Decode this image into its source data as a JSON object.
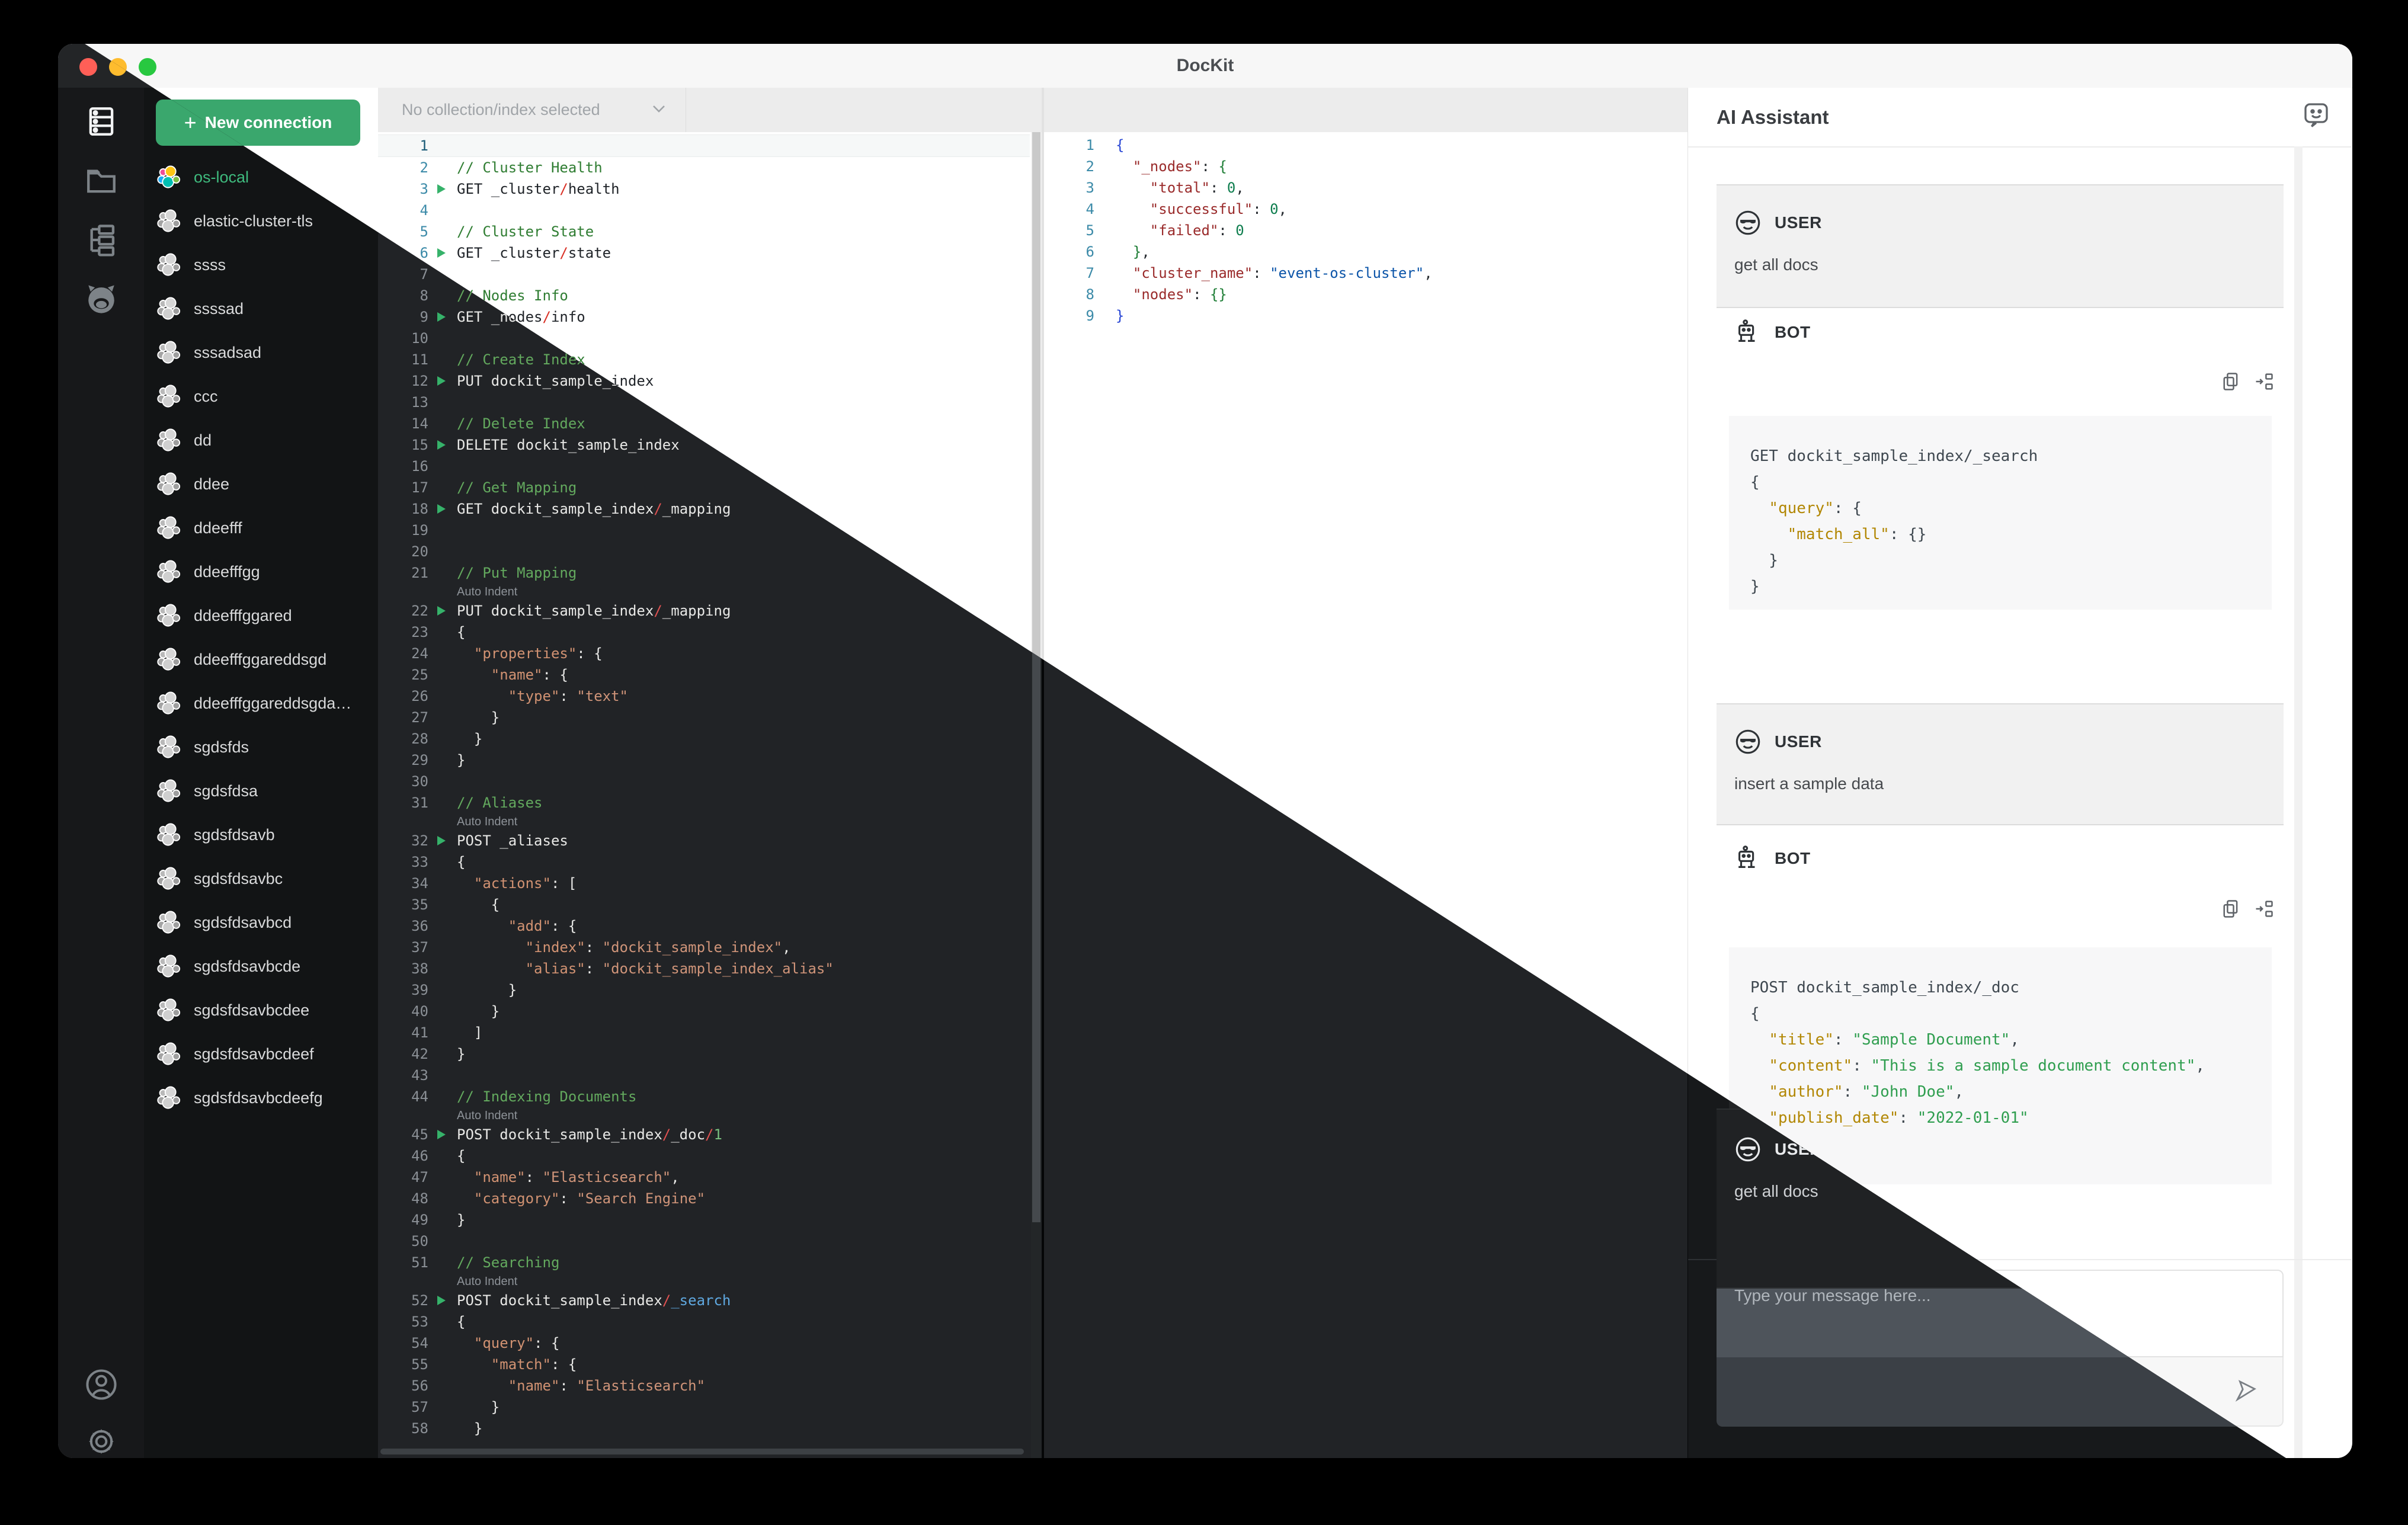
{
  "window": {
    "title": "DocKit",
    "traffic_lights": [
      "close",
      "minimize",
      "zoom"
    ]
  },
  "rail": {
    "top_icons": [
      "connections-icon",
      "folder-icon",
      "tree-icon",
      "github-icon"
    ],
    "bottom_icons": [
      "user-icon",
      "gear-icon"
    ]
  },
  "connections": {
    "new_button_label": "New connection",
    "items": [
      {
        "name": "os-local",
        "active": true
      },
      {
        "name": "elastic-cluster-tls",
        "active": false
      },
      {
        "name": "ssss",
        "active": false
      },
      {
        "name": "ssssad",
        "active": false
      },
      {
        "name": "sssadsad",
        "active": false
      },
      {
        "name": "ccc",
        "active": false
      },
      {
        "name": "dd",
        "active": false
      },
      {
        "name": "ddee",
        "active": false
      },
      {
        "name": "ddeefff",
        "active": false
      },
      {
        "name": "ddeefffgg",
        "active": false
      },
      {
        "name": "ddeefffggared",
        "active": false
      },
      {
        "name": "ddeefffggareddsgd",
        "active": false
      },
      {
        "name": "ddeefffggareddsgda…",
        "active": false
      },
      {
        "name": "sgdsfds",
        "active": false
      },
      {
        "name": "sgdsfdsa",
        "active": false
      },
      {
        "name": "sgdsfdsavb",
        "active": false
      },
      {
        "name": "sgdsfdsavbc",
        "active": false
      },
      {
        "name": "sgdsfdsavbcd",
        "active": false
      },
      {
        "name": "sgdsfdsavbcde",
        "active": false
      },
      {
        "name": "sgdsfdsavbcdee",
        "active": false
      },
      {
        "name": "sgdsfdsavbcdeef",
        "active": false
      },
      {
        "name": "sgdsfdsavbcdeefg",
        "active": false
      }
    ]
  },
  "toolbar": {
    "collection_placeholder": "No collection/index selected"
  },
  "editor": {
    "lens_label": "Auto Indent",
    "lines": [
      {
        "n": 1,
        "hl": true,
        "segs": []
      },
      {
        "n": 2,
        "segs": [
          [
            "// Cluster Health",
            "c"
          ]
        ]
      },
      {
        "n": 3,
        "run": true,
        "segs": [
          [
            "GET _cluster",
            "t"
          ],
          [
            "/",
            "s"
          ],
          [
            "health",
            "t"
          ]
        ]
      },
      {
        "n": 4,
        "segs": []
      },
      {
        "n": 5,
        "segs": [
          [
            "// Cluster State",
            "c"
          ]
        ]
      },
      {
        "n": 6,
        "run": true,
        "segs": [
          [
            "GET _cluster",
            "t"
          ],
          [
            "/",
            "s"
          ],
          [
            "state",
            "t"
          ]
        ]
      },
      {
        "n": 7,
        "segs": []
      },
      {
        "n": 8,
        "segs": [
          [
            "// Nodes Info",
            "c"
          ]
        ]
      },
      {
        "n": 9,
        "run": true,
        "segs": [
          [
            "GET _nodes",
            "t"
          ],
          [
            "/",
            "s"
          ],
          [
            "info",
            "t"
          ]
        ]
      },
      {
        "n": 10,
        "segs": []
      },
      {
        "n": 11,
        "segs": [
          [
            "// Create Index",
            "c"
          ]
        ]
      },
      {
        "n": 12,
        "run": true,
        "segs": [
          [
            "PUT dockit_sample_index",
            "t"
          ]
        ]
      },
      {
        "n": 13,
        "segs": []
      },
      {
        "n": 14,
        "segs": [
          [
            "// Delete Index",
            "c"
          ]
        ]
      },
      {
        "n": 15,
        "run": true,
        "segs": [
          [
            "DELETE dockit_sample_index",
            "t"
          ]
        ]
      },
      {
        "n": 16,
        "segs": []
      },
      {
        "n": 17,
        "segs": [
          [
            "// Get Mapping",
            "c"
          ]
        ]
      },
      {
        "n": 18,
        "run": true,
        "segs": [
          [
            "GET dockit_sample_index",
            "t"
          ],
          [
            "/",
            "s"
          ],
          [
            "_mapping",
            "t"
          ]
        ]
      },
      {
        "n": 19,
        "segs": []
      },
      {
        "n": 20,
        "segs": []
      },
      {
        "n": 21,
        "segs": [
          [
            "// Put Mapping",
            "c"
          ]
        ]
      },
      {
        "lens": true
      },
      {
        "n": 22,
        "run": true,
        "segs": [
          [
            "PUT dockit_sample_index",
            "t"
          ],
          [
            "/",
            "s"
          ],
          [
            "_mapping",
            "t"
          ]
        ]
      },
      {
        "n": 23,
        "segs": [
          [
            "{",
            "t"
          ]
        ]
      },
      {
        "n": 24,
        "segs": [
          [
            "  ",
            "t"
          ],
          [
            "\"properties\"",
            "k"
          ],
          [
            ": {",
            "t"
          ]
        ]
      },
      {
        "n": 25,
        "segs": [
          [
            "    ",
            "t"
          ],
          [
            "\"name\"",
            "k"
          ],
          [
            ": {",
            "t"
          ]
        ]
      },
      {
        "n": 26,
        "segs": [
          [
            "      ",
            "t"
          ],
          [
            "\"type\"",
            "k"
          ],
          [
            ": ",
            "t"
          ],
          [
            "\"text\"",
            "v"
          ]
        ]
      },
      {
        "n": 27,
        "segs": [
          [
            "    }",
            "t"
          ]
        ]
      },
      {
        "n": 28,
        "segs": [
          [
            "  }",
            "t"
          ]
        ]
      },
      {
        "n": 29,
        "segs": [
          [
            "}",
            "t"
          ]
        ]
      },
      {
        "n": 30,
        "segs": []
      },
      {
        "n": 31,
        "segs": [
          [
            "// Aliases",
            "c"
          ]
        ]
      },
      {
        "lens": true
      },
      {
        "n": 32,
        "run": true,
        "segs": [
          [
            "POST _aliases",
            "t"
          ]
        ]
      },
      {
        "n": 33,
        "segs": [
          [
            "{",
            "t"
          ]
        ]
      },
      {
        "n": 34,
        "segs": [
          [
            "  ",
            "t"
          ],
          [
            "\"actions\"",
            "k"
          ],
          [
            ": [",
            "t"
          ]
        ]
      },
      {
        "n": 35,
        "segs": [
          [
            "    {",
            "t"
          ]
        ]
      },
      {
        "n": 36,
        "segs": [
          [
            "      ",
            "t"
          ],
          [
            "\"add\"",
            "k"
          ],
          [
            ": {",
            "t"
          ]
        ]
      },
      {
        "n": 37,
        "segs": [
          [
            "        ",
            "t"
          ],
          [
            "\"index\"",
            "k"
          ],
          [
            ": ",
            "t"
          ],
          [
            "\"dockit_sample_index\"",
            "v"
          ],
          [
            ",",
            "t"
          ]
        ]
      },
      {
        "n": 38,
        "segs": [
          [
            "        ",
            "t"
          ],
          [
            "\"alias\"",
            "k"
          ],
          [
            ": ",
            "t"
          ],
          [
            "\"dockit_sample_index_alias\"",
            "v"
          ]
        ]
      },
      {
        "n": 39,
        "segs": [
          [
            "      }",
            "t"
          ]
        ]
      },
      {
        "n": 40,
        "segs": [
          [
            "    }",
            "t"
          ]
        ]
      },
      {
        "n": 41,
        "segs": [
          [
            "  ]",
            "t"
          ]
        ]
      },
      {
        "n": 42,
        "segs": [
          [
            "}",
            "t"
          ]
        ]
      },
      {
        "n": 43,
        "segs": []
      },
      {
        "n": 44,
        "segs": [
          [
            "// Indexing Documents",
            "c"
          ]
        ]
      },
      {
        "lens": true
      },
      {
        "n": 45,
        "run": true,
        "segs": [
          [
            "POST dockit_sample_index",
            "t"
          ],
          [
            "/",
            "s"
          ],
          [
            "_doc",
            "t"
          ],
          [
            "/",
            "s"
          ],
          [
            "1",
            "n"
          ]
        ]
      },
      {
        "n": 46,
        "segs": [
          [
            "{",
            "t"
          ]
        ]
      },
      {
        "n": 47,
        "segs": [
          [
            "  ",
            "t"
          ],
          [
            "\"name\"",
            "k"
          ],
          [
            ": ",
            "t"
          ],
          [
            "\"Elasticsearch\"",
            "v"
          ],
          [
            ",",
            "t"
          ]
        ]
      },
      {
        "n": 48,
        "segs": [
          [
            "  ",
            "t"
          ],
          [
            "\"category\"",
            "k"
          ],
          [
            ": ",
            "t"
          ],
          [
            "\"Search Engine\"",
            "v"
          ]
        ]
      },
      {
        "n": 49,
        "segs": [
          [
            "}",
            "t"
          ]
        ]
      },
      {
        "n": 50,
        "segs": []
      },
      {
        "n": 51,
        "segs": [
          [
            "// Searching",
            "c"
          ]
        ]
      },
      {
        "lens": true
      },
      {
        "n": 52,
        "run": true,
        "segs": [
          [
            "POST dockit_sample_index",
            "t"
          ],
          [
            "/",
            "s"
          ],
          [
            "_search",
            "b"
          ]
        ]
      },
      {
        "n": 53,
        "segs": [
          [
            "{",
            "t"
          ]
        ]
      },
      {
        "n": 54,
        "segs": [
          [
            "  ",
            "t"
          ],
          [
            "\"query\"",
            "k"
          ],
          [
            ": {",
            "t"
          ]
        ]
      },
      {
        "n": 55,
        "segs": [
          [
            "    ",
            "t"
          ],
          [
            "\"match\"",
            "k"
          ],
          [
            ": {",
            "t"
          ]
        ]
      },
      {
        "n": 56,
        "segs": [
          [
            "      ",
            "t"
          ],
          [
            "\"name\"",
            "k"
          ],
          [
            ": ",
            "t"
          ],
          [
            "\"Elasticsearch\"",
            "v"
          ]
        ]
      },
      {
        "n": 57,
        "segs": [
          [
            "    }",
            "t"
          ]
        ]
      },
      {
        "n": 58,
        "segs": [
          [
            "  }",
            "t"
          ]
        ]
      }
    ]
  },
  "results": {
    "lines": [
      {
        "n": 1,
        "segs": [
          [
            "{",
            "b1"
          ]
        ]
      },
      {
        "n": 2,
        "segs": [
          [
            "  ",
            "t"
          ],
          [
            "\"_nodes\"",
            "rk"
          ],
          [
            ": ",
            "t"
          ],
          [
            "{",
            "b2"
          ]
        ]
      },
      {
        "n": 3,
        "segs": [
          [
            "    ",
            "t"
          ],
          [
            "\"total\"",
            "rk"
          ],
          [
            ": ",
            "t"
          ],
          [
            "0",
            "rn"
          ],
          [
            ",",
            "t"
          ]
        ]
      },
      {
        "n": 4,
        "segs": [
          [
            "    ",
            "t"
          ],
          [
            "\"successful\"",
            "rk"
          ],
          [
            ": ",
            "t"
          ],
          [
            "0",
            "rn"
          ],
          [
            ",",
            "t"
          ]
        ]
      },
      {
        "n": 5,
        "segs": [
          [
            "    ",
            "t"
          ],
          [
            "\"failed\"",
            "rk"
          ],
          [
            ": ",
            "t"
          ],
          [
            "0",
            "rn"
          ]
        ]
      },
      {
        "n": 6,
        "segs": [
          [
            "  ",
            "t"
          ],
          [
            "}",
            "b2"
          ],
          [
            ",",
            "t"
          ]
        ]
      },
      {
        "n": 7,
        "segs": [
          [
            "  ",
            "t"
          ],
          [
            "\"cluster_name\"",
            "rk"
          ],
          [
            ": ",
            "t"
          ],
          [
            "\"event-os-cluster\"",
            "rs"
          ],
          [
            ",",
            "t"
          ]
        ]
      },
      {
        "n": 8,
        "segs": [
          [
            "  ",
            "t"
          ],
          [
            "\"nodes\"",
            "rk"
          ],
          [
            ": ",
            "t"
          ],
          [
            "{}",
            "b2"
          ]
        ]
      },
      {
        "n": 9,
        "segs": [
          [
            "}",
            "b1"
          ]
        ]
      }
    ]
  },
  "assistant": {
    "title": "AI Assistant",
    "user_label": "USER",
    "bot_label": "BOT",
    "message1_text": "get all docs",
    "message2_text": "insert a sample data",
    "overlap_text": "get all docs",
    "input_placeholder": "Type your message here...",
    "icons": [
      "copy-icon",
      "insert-to-editor-icon",
      "send-icon",
      "feedback-smiley-icon"
    ],
    "code1": {
      "lines": [
        [
          [
            "GET dockit_sample_index/_search",
            "m"
          ]
        ],
        [
          [
            "{",
            "m"
          ]
        ],
        [
          [
            "  ",
            "m"
          ],
          [
            "\"query\"",
            "ak"
          ],
          [
            ": {",
            "m"
          ]
        ],
        [
          [
            "    ",
            "m"
          ],
          [
            "\"match_all\"",
            "ak"
          ],
          [
            ": {}",
            "m"
          ]
        ],
        [
          [
            "  }",
            "m"
          ]
        ],
        [
          [
            "}",
            "m"
          ]
        ]
      ]
    },
    "code2": {
      "lines": [
        [
          [
            "POST dockit_sample_index/_doc",
            "m"
          ]
        ],
        [
          [
            "{",
            "m"
          ]
        ],
        [
          [
            "  ",
            "m"
          ],
          [
            "\"title\"",
            "ak"
          ],
          [
            ": ",
            "m"
          ],
          [
            "\"Sample Document\"",
            "av"
          ],
          [
            ",",
            "m"
          ]
        ],
        [
          [
            "  ",
            "m"
          ],
          [
            "\"content\"",
            "ak"
          ],
          [
            ": ",
            "m"
          ],
          [
            "\"This is a sample document content\"",
            "av"
          ],
          [
            ",",
            "m"
          ]
        ],
        [
          [
            "  ",
            "m"
          ],
          [
            "\"author\"",
            "ak"
          ],
          [
            ": ",
            "m"
          ],
          [
            "\"John Doe\"",
            "av"
          ],
          [
            ",",
            "m"
          ]
        ],
        [
          [
            "  ",
            "m"
          ],
          [
            "\"publish_date\"",
            "ak"
          ],
          [
            ": ",
            "m"
          ],
          [
            "\"2022-01-01\"",
            "av"
          ]
        ],
        [
          [
            "}",
            "m"
          ]
        ]
      ]
    }
  },
  "colors": {
    "accent_green": "#3aa76d",
    "active_connection_green": "#3fbb7e",
    "slash_red": "#d93025",
    "traffic_red": "#ff5f57",
    "traffic_yellow": "#febc2e",
    "traffic_green": "#28c840"
  }
}
